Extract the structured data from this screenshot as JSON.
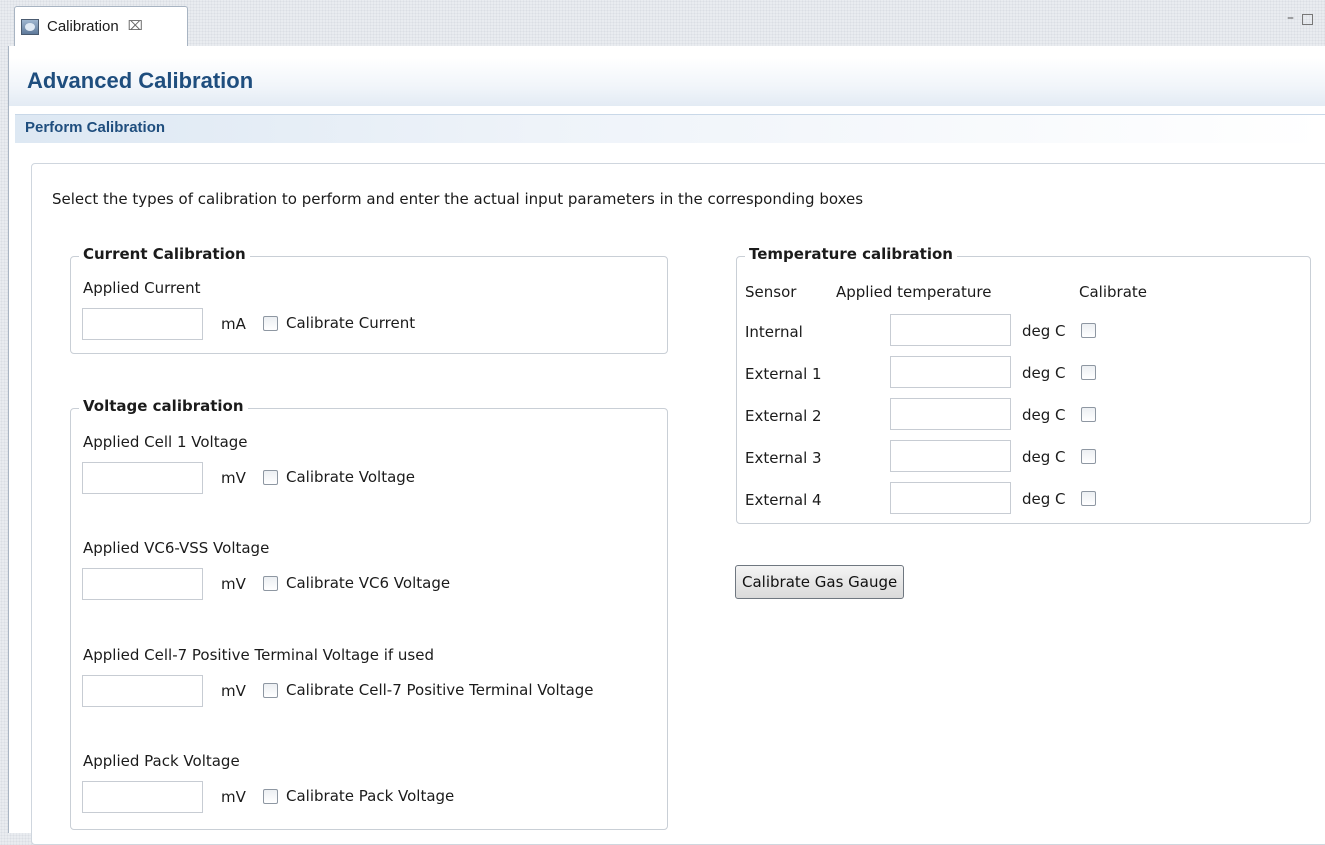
{
  "tab": {
    "label": "Calibration",
    "close_glyph": "⌧"
  },
  "window": {
    "minimize_glyph": "–"
  },
  "page": {
    "title": "Advanced Calibration",
    "section_title": "Perform Calibration",
    "instructions": "Select the types of calibration to perform and enter the actual input parameters in the corresponding boxes"
  },
  "current": {
    "title": "Current Calibration",
    "field_label": "Applied Current",
    "value": "",
    "unit": "mA",
    "checkbox_label": "Calibrate Current"
  },
  "voltage": {
    "title": "Voltage calibration",
    "rows": [
      {
        "label": "Applied Cell 1 Voltage",
        "value": "",
        "unit": "mV",
        "checkbox_label": "Calibrate Voltage"
      },
      {
        "label": "Applied VC6-VSS Voltage",
        "value": "",
        "unit": "mV",
        "checkbox_label": "Calibrate VC6 Voltage"
      },
      {
        "label": "Applied Cell-7 Positive Terminal Voltage if used",
        "value": "",
        "unit": "mV",
        "checkbox_label": "Calibrate Cell-7 Positive Terminal Voltage"
      },
      {
        "label": "Applied Pack Voltage",
        "value": "",
        "unit": "mV",
        "checkbox_label": "Calibrate Pack Voltage"
      }
    ]
  },
  "temperature": {
    "title": "Temperature calibration",
    "headers": {
      "sensor": "Sensor",
      "applied": "Applied temperature",
      "calibrate": "Calibrate"
    },
    "rows": [
      {
        "sensor": "Internal",
        "value": "",
        "unit": "deg C"
      },
      {
        "sensor": "External 1",
        "value": "",
        "unit": "deg C"
      },
      {
        "sensor": "External 2",
        "value": "",
        "unit": "deg C"
      },
      {
        "sensor": "External 3",
        "value": "",
        "unit": "deg C"
      },
      {
        "sensor": "External 4",
        "value": "",
        "unit": "deg C"
      }
    ]
  },
  "actions": {
    "calibrate_button": "Calibrate Gas Gauge"
  }
}
